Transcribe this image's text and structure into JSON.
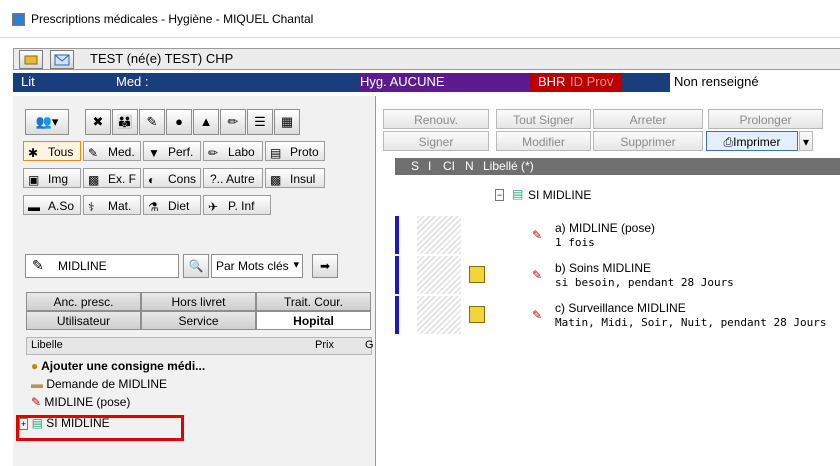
{
  "window": {
    "title": "Prescriptions médicales - Hygiène - MIQUEL  Chantal"
  },
  "patient": {
    "name": "TEST (né(e) TEST) CHP"
  },
  "info": {
    "lit": "Lit",
    "med": "Med :",
    "hyg": "Hyg. AUCUNE",
    "bhr": "BHR",
    "idprov": "ID Prov",
    "idprov_value": "Non renseigné"
  },
  "categories": [
    {
      "label": "Tous",
      "icon": "asterisk"
    },
    {
      "label": "Med.",
      "icon": "syringe"
    },
    {
      "label": "Perf.",
      "icon": "perfusion"
    },
    {
      "label": "Labo",
      "icon": "tube"
    },
    {
      "label": "Proto",
      "icon": "document"
    },
    {
      "label": "Img",
      "icon": "image"
    },
    {
      "label": "Ex. F",
      "icon": "exam"
    },
    {
      "label": "Cons",
      "icon": "bowl"
    },
    {
      "label": "?.. Autre",
      "icon": "question"
    },
    {
      "label": "Insul",
      "icon": "insulin"
    },
    {
      "label": "A.So",
      "icon": "bandage"
    },
    {
      "label": "Mat.",
      "icon": "material"
    },
    {
      "label": "Diet",
      "icon": "cutlery"
    },
    {
      "label": "P. Inf",
      "icon": "nurse"
    }
  ],
  "search": {
    "value": "MIDLINE",
    "mode": "Par Mots clés"
  },
  "tabs": {
    "row1": [
      "Anc. presc.",
      "Hors livret",
      "Trait. Cour."
    ],
    "row2": [
      "Utilisateur",
      "Service",
      "Hopital"
    ]
  },
  "list": {
    "header_libelle": "Libelle",
    "header_prix": "Prix",
    "header_g": "G",
    "items": [
      "Ajouter une consigne médi...",
      "Demande de MIDLINE",
      "MIDLINE (pose)",
      "SI MIDLINE"
    ]
  },
  "actions": {
    "renouv": "Renouv.",
    "tout_signer": "Tout Signer",
    "arreter": "Arreter",
    "prolonger": "Prolonger",
    "signer": "Signer",
    "modifier": "Modifier",
    "supprimer": "Supprimer",
    "imprimer": "Imprimer"
  },
  "grid": {
    "cols": [
      "S",
      "I",
      "CI",
      "N",
      "Libellé (*)"
    ],
    "group": "SI MIDLINE",
    "rows": [
      {
        "title": "a) MIDLINE (pose)",
        "sub": "1 fois"
      },
      {
        "title": "b) Soins MIDLINE",
        "sub": "si besoin, pendant 28 Jours"
      },
      {
        "title": "c) Surveillance MIDLINE",
        "sub": "Matin, Midi, Soir, Nuit, pendant 28 Jours"
      }
    ]
  }
}
